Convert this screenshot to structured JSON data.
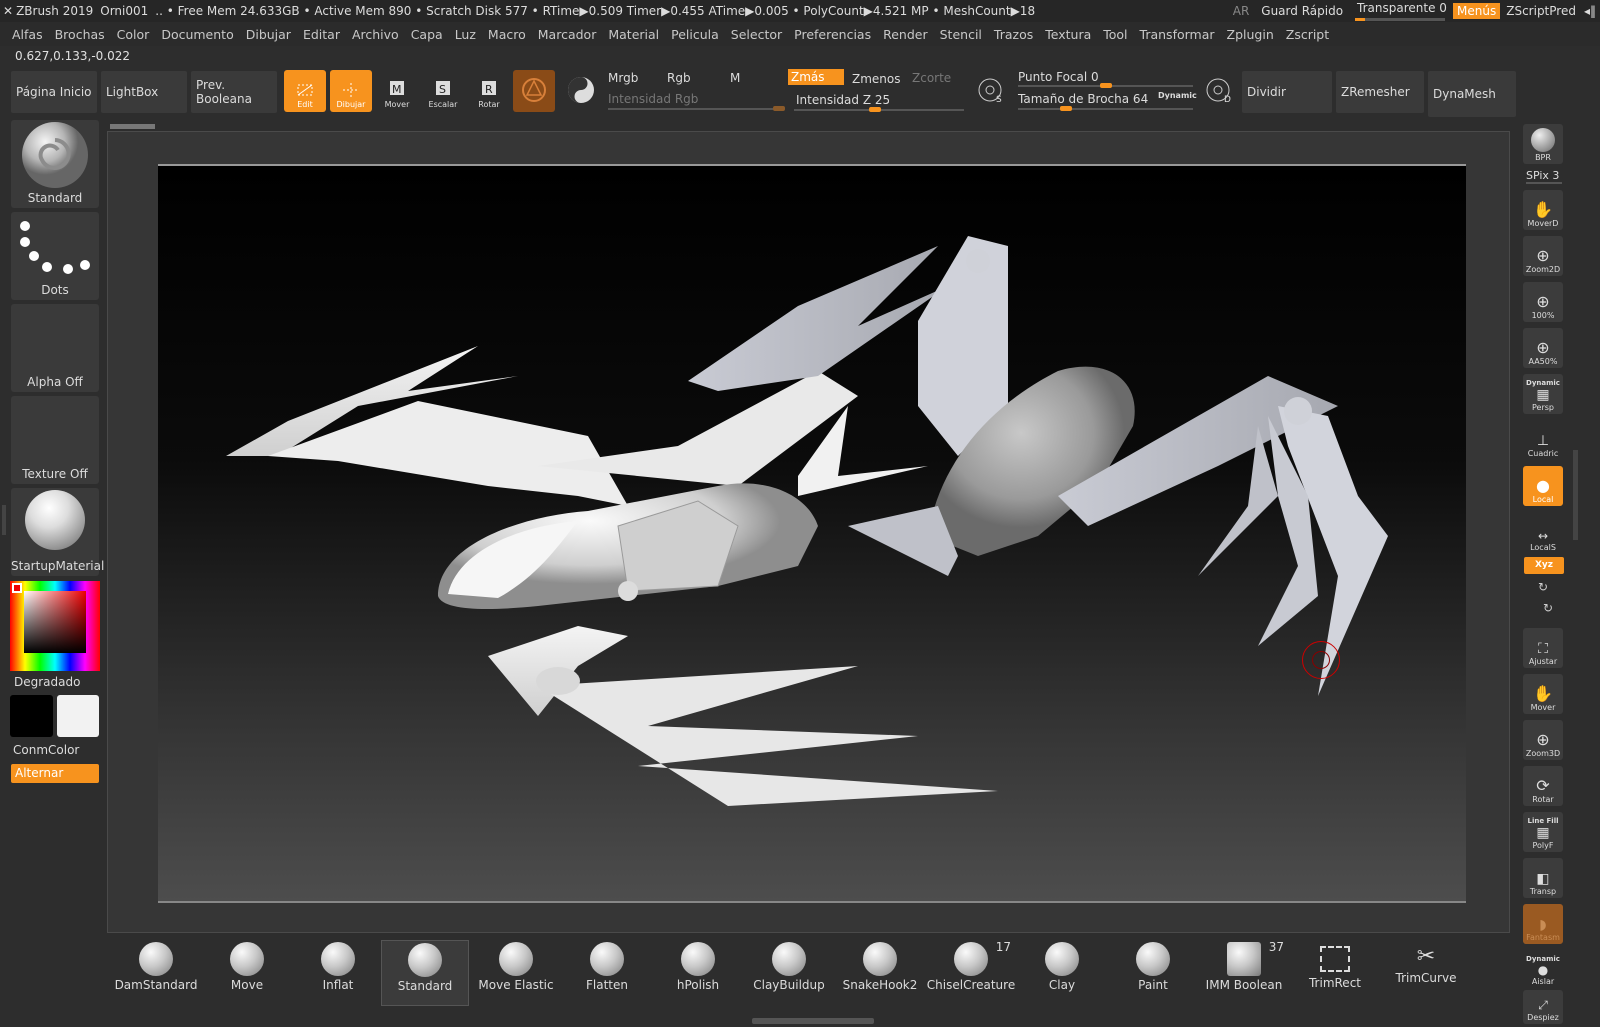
{
  "titlebar": {
    "app": "ZBrush 2019",
    "doc": "Orni001",
    "stats": ".. • Free Mem 24.633GB • Active Mem 890 • Scratch Disk 577 •  RTime▶0.509 Timer▶0.455 ATime▶0.005 • PolyCount▶4.521 MP  • MeshCount▶18",
    "ar": "AR",
    "quicksave": "Guard Rápido",
    "transparent": "Transparente 0",
    "menus": "Menús",
    "zscriptpred": "ZScriptPred"
  },
  "menubar": [
    "Alfas",
    "Brochas",
    "Color",
    "Documento",
    "Dibujar",
    "Editar",
    "Archivo",
    "Capa",
    "Luz",
    "Macro",
    "Marcador",
    "Material",
    "Pelicula",
    "Selector",
    "Preferencias",
    "Render",
    "Stencil",
    "Trazos",
    "Textura",
    "Tool",
    "Transformar",
    "Zplugin",
    "Zscript"
  ],
  "coords": "0.627,0.133,-0.022",
  "toolbar": {
    "home": "Página Inicio",
    "lightbox": "LightBox",
    "boolean": "Prev. Booleana",
    "edit": "Edit",
    "draw": "Dibujar",
    "move": "Mover",
    "scale": "Escalar",
    "rotate": "Rotar",
    "mrgb": "Mrgb",
    "rgb": "Rgb",
    "m": "M",
    "rgb_intensity": "Intensidad Rgb",
    "zadd": "Zmás",
    "zsub": "Zmenos",
    "zcut": "Zcorte",
    "z_intensity": "Intensidad Z 25",
    "focal": "Punto Focal 0",
    "draw_size": "Tamaño de Brocha 64",
    "dynamic": "Dynamic",
    "divide": "Dividir",
    "zremesher": "ZRemesher",
    "dynamesh": "DynaMesh"
  },
  "leftpanel": {
    "brush": "Standard",
    "stroke": "Dots",
    "alpha": "Alpha Off",
    "texture": "Texture Off",
    "material": "StartupMaterial",
    "gradient": "Degradado",
    "switchcolor": "ConmColor",
    "alternate": "Alternar"
  },
  "rightshelf": {
    "bpr": "BPR",
    "spix": "SPix 3",
    "moved": "MoverD",
    "zoom2d": "Zoom2D",
    "actual": "100%",
    "aahalf": "AA50%",
    "persp_top": "Dynamic",
    "persp": "Persp",
    "floor": "Cuadric",
    "local": "Local",
    "locals": "LocalS",
    "xyz": "Xyz",
    "frame": "Ajustar",
    "move": "Mover",
    "zoom3d": "Zoom3D",
    "rotate": "Rotar",
    "polyf_top": "Line Fill",
    "polyf": "PolyF",
    "transp": "Transp",
    "ghost": "Fantasm",
    "solo_top": "Dynamic",
    "solo": "Aislar",
    "xpose": "Despiez"
  },
  "brushes": [
    {
      "name": "DamStandard",
      "count": ""
    },
    {
      "name": "Move",
      "count": ""
    },
    {
      "name": "Inflat",
      "count": ""
    },
    {
      "name": "Standard",
      "count": ""
    },
    {
      "name": "Move Elastic",
      "count": ""
    },
    {
      "name": "Flatten",
      "count": ""
    },
    {
      "name": "hPolish",
      "count": ""
    },
    {
      "name": "ClayBuildup",
      "count": ""
    },
    {
      "name": "SnakeHook2",
      "count": ""
    },
    {
      "name": "ChiselCreature",
      "count": "17"
    },
    {
      "name": "Clay",
      "count": ""
    },
    {
      "name": "Paint",
      "count": ""
    },
    {
      "name": "IMM Boolean",
      "count": "37"
    },
    {
      "name": "TrimRect",
      "count": ""
    },
    {
      "name": "TrimCurve",
      "count": ""
    }
  ],
  "colors": {
    "accent": "#f7931e",
    "panel": "#3a3a3a",
    "bg": "#2d2d2d"
  }
}
